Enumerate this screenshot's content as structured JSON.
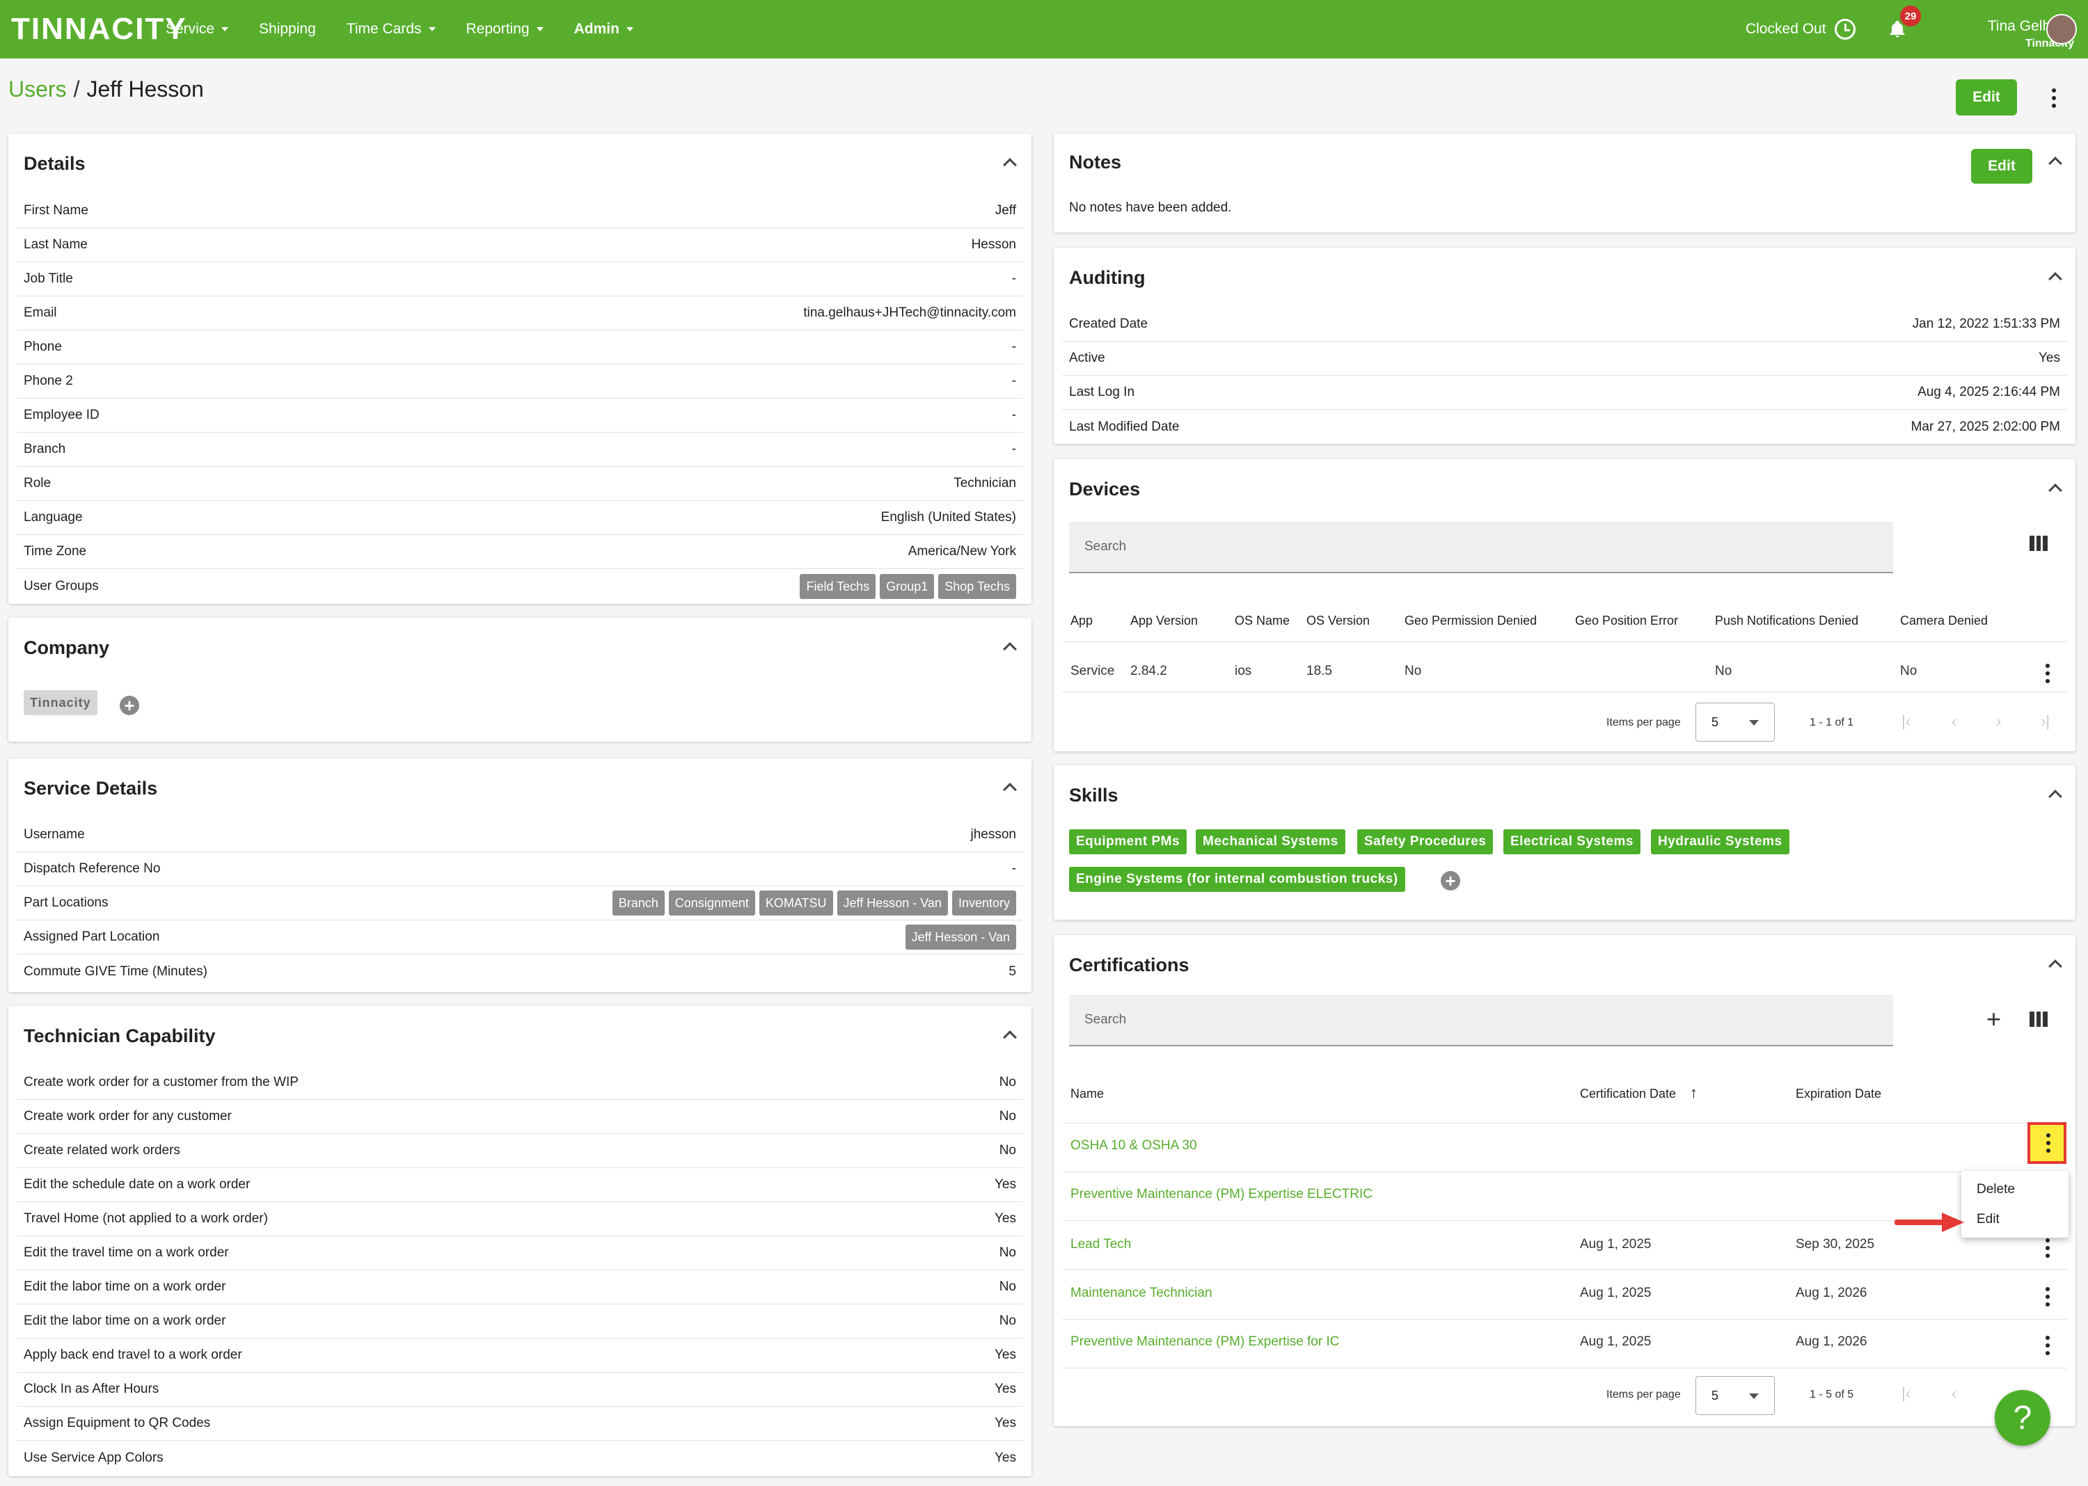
{
  "app": {
    "logo": "TINNACITY"
  },
  "nav": {
    "items": [
      {
        "label": "Service",
        "caret": true
      },
      {
        "label": "Shipping",
        "caret": false
      },
      {
        "label": "Time Cards",
        "caret": true
      },
      {
        "label": "Reporting",
        "caret": true
      },
      {
        "label": "Admin",
        "caret": true
      }
    ],
    "clock_status": "Clocked Out",
    "notification_count": "29",
    "user_name": "Tina Gelhaus",
    "user_company": "Tinnacity"
  },
  "breadcrumb": {
    "parent": "Users",
    "separator": "/",
    "current": "Jeff Hesson"
  },
  "header": {
    "edit_label": "Edit"
  },
  "details": {
    "title": "Details",
    "rows": [
      {
        "label": "First Name",
        "value": "Jeff"
      },
      {
        "label": "Last Name",
        "value": "Hesson"
      },
      {
        "label": "Job Title",
        "value": "-"
      },
      {
        "label": "Email",
        "value": "tina.gelhaus+JHTech@tinnacity.com"
      },
      {
        "label": "Phone",
        "value": "-"
      },
      {
        "label": "Phone 2",
        "value": "-"
      },
      {
        "label": "Employee ID",
        "value": "-"
      },
      {
        "label": "Branch",
        "value": "-"
      },
      {
        "label": "Role",
        "value": "Technician"
      },
      {
        "label": "Language",
        "value": "English (United States)"
      },
      {
        "label": "Time Zone",
        "value": "America/New York"
      }
    ],
    "user_groups_label": "User Groups",
    "user_groups": [
      "Field Techs",
      "Group1",
      "Shop Techs"
    ]
  },
  "company": {
    "title": "Company",
    "chip": "Tinnacity",
    "add": "+"
  },
  "service_details": {
    "title": "Service Details",
    "username_label": "Username",
    "username": "jhesson",
    "dispatch_label": "Dispatch Reference No",
    "dispatch": "-",
    "part_locations_label": "Part Locations",
    "part_locations": [
      "Branch",
      "Consignment",
      "KOMATSU",
      "Jeff Hesson - Van",
      "Inventory"
    ],
    "assigned_label": "Assigned Part Location",
    "assigned": "Jeff Hesson - Van",
    "commute_label": "Commute GIVE Time (Minutes)",
    "commute": "5"
  },
  "tech_capability": {
    "title": "Technician Capability",
    "rows": [
      {
        "label": "Create work order for a customer from the WIP",
        "value": "No"
      },
      {
        "label": "Create work order for any customer",
        "value": "No"
      },
      {
        "label": "Create related work orders",
        "value": "No"
      },
      {
        "label": "Edit the schedule date on a work order",
        "value": "Yes"
      },
      {
        "label": "Travel Home (not applied to a work order)",
        "value": "Yes"
      },
      {
        "label": "Edit the travel time on a work order",
        "value": "No"
      },
      {
        "label": "Edit the labor time on a work order",
        "value": "No"
      },
      {
        "label": "Edit the labor time on a work order",
        "value": "No"
      },
      {
        "label": "Apply back end travel to a work order",
        "value": "Yes"
      },
      {
        "label": "Clock In as After Hours",
        "value": "Yes"
      },
      {
        "label": "Assign Equipment to QR Codes",
        "value": "Yes"
      },
      {
        "label": "Use Service App Colors",
        "value": "Yes"
      }
    ]
  },
  "notes": {
    "title": "Notes",
    "edit_label": "Edit",
    "empty": "No notes have been added."
  },
  "auditing": {
    "title": "Auditing",
    "rows": [
      {
        "label": "Created Date",
        "value": "Jan 12, 2022 1:51:33 PM"
      },
      {
        "label": "Active",
        "value": "Yes"
      },
      {
        "label": "Last Log In",
        "value": "Aug 4, 2025 2:16:44 PM"
      },
      {
        "label": "Last Modified Date",
        "value": "Mar 27, 2025 2:02:00 PM"
      }
    ]
  },
  "devices": {
    "title": "Devices",
    "search_placeholder": "Search",
    "columns": [
      "App",
      "App Version",
      "OS Name",
      "OS Version",
      "Geo Permission Denied",
      "Geo Position Error",
      "Push Notifications Denied",
      "Camera Denied"
    ],
    "row": [
      "Service",
      "2.84.2",
      "ios",
      "18.5",
      "No",
      "",
      "No",
      "No"
    ],
    "items_per_page_label": "Items per page",
    "items_per_page": "5",
    "range": "1 - 1 of 1"
  },
  "skills": {
    "title": "Skills",
    "chips": [
      "Equipment PMs",
      "Mechanical Systems",
      "Safety Procedures",
      "Electrical Systems",
      "Hydraulic Systems",
      "Engine Systems (for internal combustion trucks)"
    ]
  },
  "certifications": {
    "title": "Certifications",
    "search_placeholder": "Search",
    "columns": [
      "Name",
      "Certification Date",
      "Expiration Date"
    ],
    "rows": [
      {
        "name": "OSHA 10 & OSHA 30",
        "cert_date": "",
        "exp_date": ""
      },
      {
        "name": "Preventive Maintenance (PM) Expertise ELECTRIC",
        "cert_date": "",
        "exp_date": ""
      },
      {
        "name": "Lead Tech",
        "cert_date": "Aug 1, 2025",
        "exp_date": "Sep 30, 2025"
      },
      {
        "name": "Maintenance Technician",
        "cert_date": "Aug 1, 2025",
        "exp_date": "Aug 1, 2026"
      },
      {
        "name": "Preventive Maintenance (PM) Expertise for IC",
        "cert_date": "Aug 1, 2025",
        "exp_date": "Aug 1, 2026"
      }
    ],
    "items_per_page_label": "Items per page",
    "items_per_page": "5",
    "range": "1 - 5 of 5",
    "menu": {
      "delete": "Delete",
      "edit": "Edit"
    }
  },
  "help": {
    "label": "?"
  },
  "colors": {
    "brand": "#58ad2d",
    "button": "#4caf28",
    "chip_gray": "#8c8c8c",
    "highlight": "#ffeb3b",
    "highlight_border": "#e53935"
  }
}
